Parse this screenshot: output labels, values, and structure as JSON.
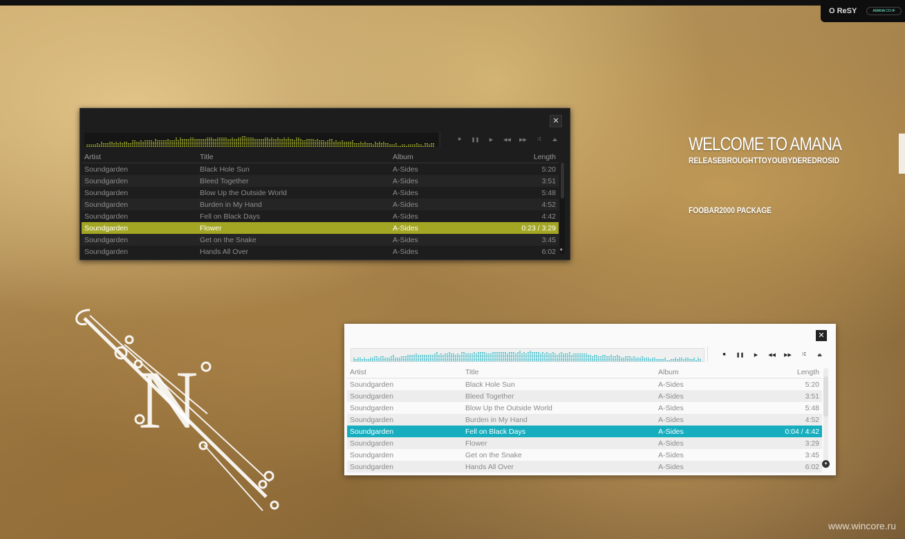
{
  "desktop": {
    "welcome_title": "WELCOME TO AMANA",
    "welcome_subtitle": "RELEASEBROUGHTTOYOUBYDEREDROSID",
    "package": "FOOBAR2000 PACKAGE",
    "watermark": "www.wincore.ru",
    "logo_letter": "N"
  },
  "tray": {
    "logo_text": "O ReSY",
    "brand_text": "AMANA CO-IF"
  },
  "player_dark": {
    "close": "✕",
    "accent": "#a3a623",
    "columns": [
      "Artist",
      "Title",
      "Album",
      "Length"
    ],
    "tracks": [
      {
        "artist": "Soundgarden",
        "title": "Black Hole Sun",
        "album": "A-Sides",
        "length": "5:20"
      },
      {
        "artist": "Soundgarden",
        "title": "Bleed Together",
        "album": "A-Sides",
        "length": "3:51"
      },
      {
        "artist": "Soundgarden",
        "title": "Blow Up the Outside World",
        "album": "A-Sides",
        "length": "5:48"
      },
      {
        "artist": "Soundgarden",
        "title": "Burden in My Hand",
        "album": "A-Sides",
        "length": "4:52"
      },
      {
        "artist": "Soundgarden",
        "title": "Fell on Black Days",
        "album": "A-Sides",
        "length": "4:42"
      },
      {
        "artist": "Soundgarden",
        "title": "Flower",
        "album": "A-Sides",
        "length": "0:23 / 3:29"
      },
      {
        "artist": "Soundgarden",
        "title": "Get on the Snake",
        "album": "A-Sides",
        "length": "3:45"
      },
      {
        "artist": "Soundgarden",
        "title": "Hands All Over",
        "album": "A-Sides",
        "length": "6:02"
      }
    ]
  },
  "player_light": {
    "close": "✕",
    "accent": "#16aebe",
    "columns": [
      "Artist",
      "Title",
      "Album",
      "Length"
    ],
    "tracks": [
      {
        "artist": "Soundgarden",
        "title": "Black Hole Sun",
        "album": "A-Sides",
        "length": "5:20"
      },
      {
        "artist": "Soundgarden",
        "title": "Bleed Together",
        "album": "A-Sides",
        "length": "3:51"
      },
      {
        "artist": "Soundgarden",
        "title": "Blow Up the Outside World",
        "album": "A-Sides",
        "length": "5:48"
      },
      {
        "artist": "Soundgarden",
        "title": "Burden in My Hand",
        "album": "A-Sides",
        "length": "4:52"
      },
      {
        "artist": "Soundgarden",
        "title": "Fell on Black Days",
        "album": "A-Sides",
        "length": "0:04 / 4:42"
      },
      {
        "artist": "Soundgarden",
        "title": "Flower",
        "album": "A-Sides",
        "length": "3:29"
      },
      {
        "artist": "Soundgarden",
        "title": "Get on the Snake",
        "album": "A-Sides",
        "length": "3:45"
      },
      {
        "artist": "Soundgarden",
        "title": "Hands All Over",
        "album": "A-Sides",
        "length": "6:02"
      }
    ]
  },
  "controls": {
    "stop_icon": "■",
    "pause_icon": "❚❚",
    "play_icon": "▶",
    "prev_icon": "◀◀",
    "next_icon": "▶▶",
    "random_icon": "⤮",
    "eject_icon": "⏏"
  }
}
